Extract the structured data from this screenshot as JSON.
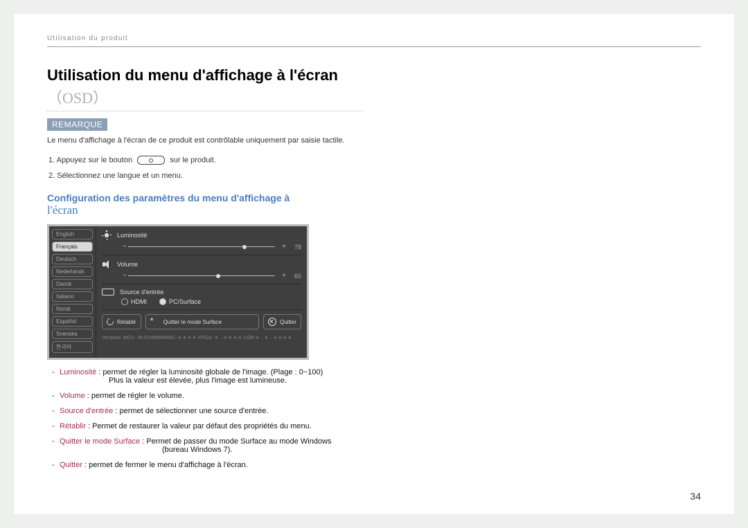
{
  "crumb": "Utilisation du produit",
  "title": "Utilisation du menu d'affichage à l'écran",
  "title_osd": "（OSD）",
  "remark_label": "REMARQUE",
  "remark_text": "Le menu d'affichage à l'écran de ce produit est contrôlable uniquement par saisie tactile.",
  "steps": {
    "s1a": "1.  Appuyez sur le bouton",
    "s1b": "sur le produit.",
    "s2": "2.  Sélectionnez une langue et un menu."
  },
  "h2": "Configuration des paramètres du menu d'affichage à",
  "h2_sub": "l'écran",
  "osd": {
    "languages": [
      "English",
      "Français",
      "Deutsch",
      "Nederlands",
      "Dansk",
      "Italiano",
      "Norsk",
      "Español",
      "Svenska",
      "한국어"
    ],
    "selected_lang_index": 1,
    "brightness": {
      "label": "Luminosité",
      "value": "78",
      "slider_pct": 78
    },
    "volume": {
      "label": "Volume",
      "value": "60",
      "slider_pct": 60
    },
    "source": {
      "label": "Source d'entrée",
      "opt1": "HDMI",
      "opt2": "PC/Surface",
      "selected": 1
    },
    "reset": "Rétablir",
    "exit_surf": "Quitter le mode Surface",
    "quit": "Quitter",
    "version": "Versions:  MCU : M-SU40MWWAC-＊＊＊＊    FPGA: ＊ . ＊＊＊＊    USB:＊ . ＊ . ＊＊＊＊"
  },
  "desc": {
    "luminosite_t": "Luminosité",
    "luminosite_d": " : permet de régler la luminosité globale de l'image. (Plage : 0~100)",
    "luminosite_d2": "Plus la valeur est élevée, plus l'image est lumineuse.",
    "volume_t": "Volume",
    "volume_d": " : permet de régler le volume.",
    "source_t": "Source d'entrée",
    "source_d": " : permet de sélectionner une source d'entrée.",
    "retablir_t": "Rétablir",
    "retablir_d": " : Permet de restaurer la valeur par défaut des propriétés du menu.",
    "qms_t": "Quitter le mode Surface",
    "qms_d": " : Permet de passer du mode Surface au mode Windows",
    "qms_d2": "(bureau Windows 7).",
    "quit_t": "Quitter",
    "quit_d": " : permet de fermer le menu d'affichage à l'écran."
  },
  "page": "34"
}
